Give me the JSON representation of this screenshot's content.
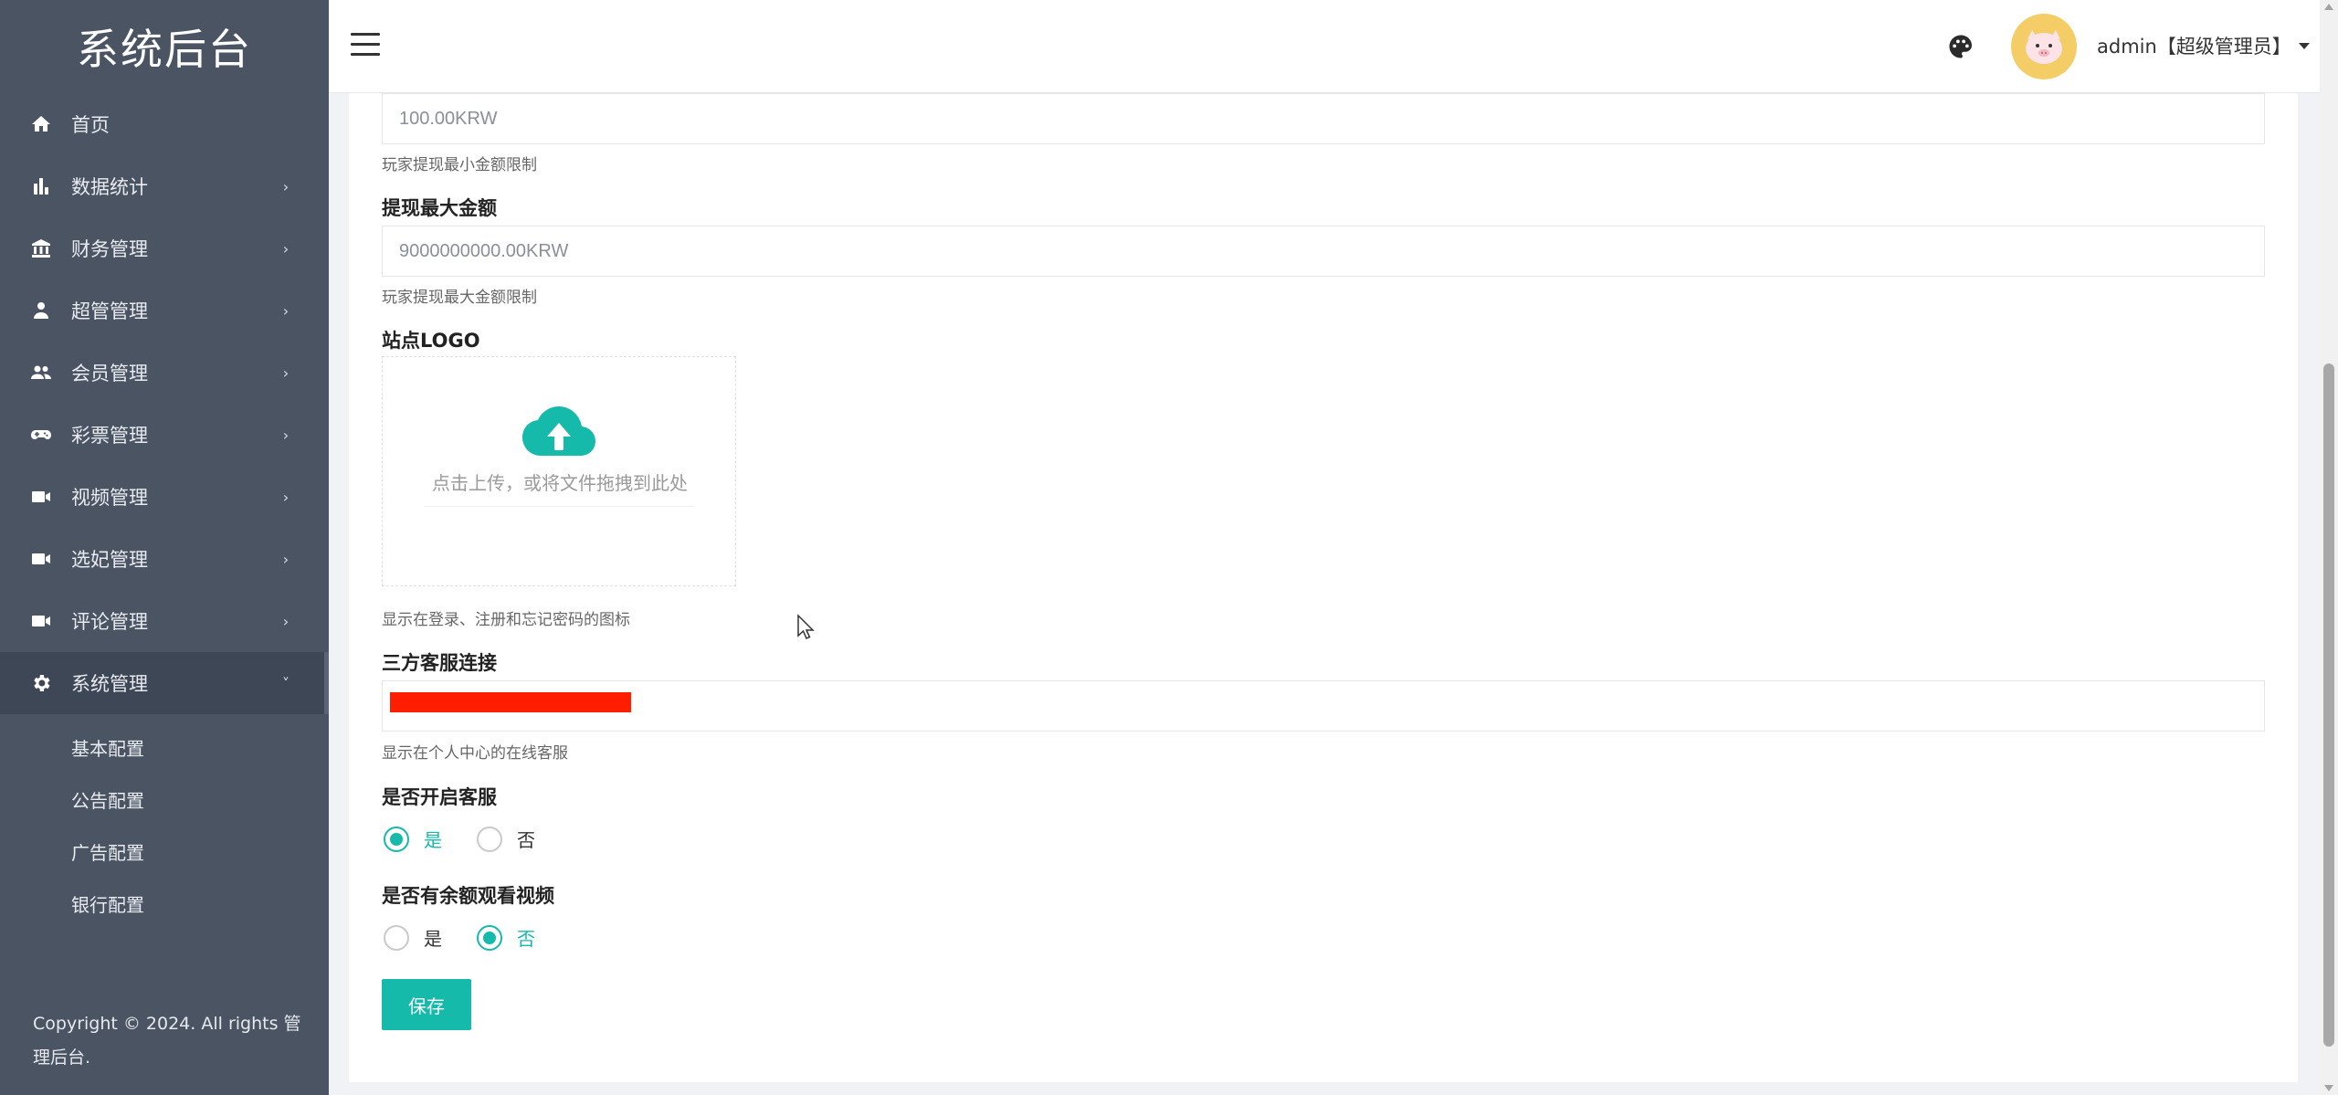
{
  "sidebar": {
    "brand": "系统后台",
    "items": [
      {
        "label": "首页",
        "icon": "home-icon"
      },
      {
        "label": "数据统计",
        "icon": "bar-chart-icon"
      },
      {
        "label": "财务管理",
        "icon": "bank-icon"
      },
      {
        "label": "超管管理",
        "icon": "user-icon"
      },
      {
        "label": "会员管理",
        "icon": "users-icon"
      },
      {
        "label": "彩票管理",
        "icon": "gamepad-icon"
      },
      {
        "label": "视频管理",
        "icon": "video-icon"
      },
      {
        "label": "选妃管理",
        "icon": "video-icon"
      },
      {
        "label": "评论管理",
        "icon": "video-icon"
      },
      {
        "label": "系统管理",
        "icon": "gear-icon"
      }
    ],
    "submenu": [
      "基本配置",
      "公告配置",
      "广告配置",
      "银行配置"
    ],
    "copyright": "Copyright © 2024. All rights 管理后台."
  },
  "header": {
    "user": "admin【超级管理员】"
  },
  "form": {
    "min_amount_value": "100.00KRW",
    "min_amount_help": "玩家提现最小金额限制",
    "max_amount_label": "提现最大金额",
    "max_amount_value": "9000000000.00KRW",
    "max_amount_help": "玩家提现最大金额限制",
    "logo_label": "站点LOGO",
    "upload_text": "点击上传，或将文件拖拽到此处",
    "logo_help": "显示在登录、注册和忘记密码的图标",
    "service_link_label": "三方客服连接",
    "service_link_help": "显示在个人中心的在线客服",
    "enable_service_label": "是否开启客服",
    "enable_service_options": [
      "是",
      "否"
    ],
    "enable_service_selected": "是",
    "balance_video_label": "是否有余额观看视频",
    "balance_video_options": [
      "是",
      "否"
    ],
    "balance_video_selected": "否",
    "save_label": "保存"
  },
  "colors": {
    "accent": "#16baaa",
    "sidebar_bg": "#4a5463",
    "redaction": "#ff1e00"
  }
}
